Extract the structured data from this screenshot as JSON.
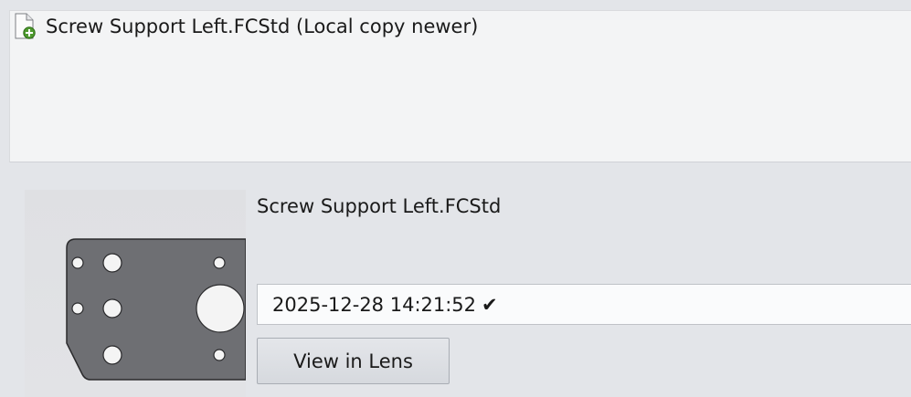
{
  "header": {
    "title": "Screw Support Left.FCStd (Local copy newer)",
    "icon": "new-file-icon"
  },
  "card": {
    "filename": "Screw Support Left.FCStd",
    "version_value": "2025-12-28 14:21:52",
    "version_status_mark": "✔",
    "view_button_label": "View in Lens",
    "thumbnail_icon": "part-thumbnail"
  },
  "colors": {
    "panel_background": "#f3f4f5",
    "page_background": "#e3e5e9",
    "part_fill": "#6e6f73",
    "button_border": "#a9adb4"
  }
}
